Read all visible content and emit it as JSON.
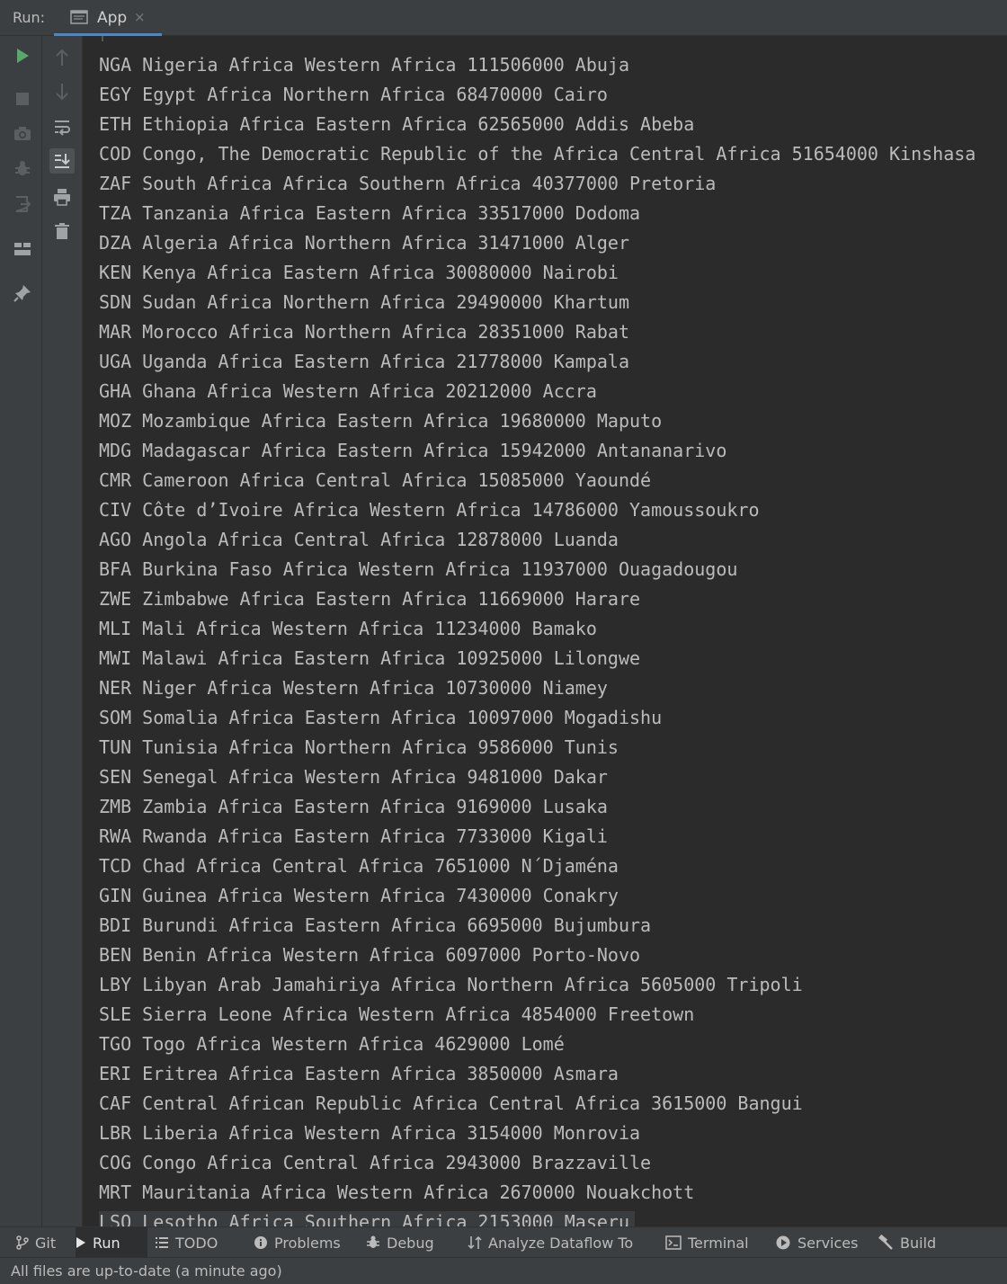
{
  "run_toolbar": {
    "run_label": "Run:",
    "tab_title": "App",
    "tab_close": "×"
  },
  "side_tools": [
    {
      "name": "rerun-icon"
    },
    {
      "name": "stop-icon"
    },
    {
      "name": "camera-icon"
    },
    {
      "name": "debug-icon"
    },
    {
      "name": "exit-icon"
    },
    {
      "name": "layout-icon"
    },
    {
      "name": "pin-icon"
    }
  ],
  "console_tools": [
    {
      "name": "scroll-up-icon"
    },
    {
      "name": "scroll-down-icon"
    },
    {
      "name": "soft-wrap-icon"
    },
    {
      "name": "scroll-to-end-icon"
    },
    {
      "name": "print-icon"
    },
    {
      "name": "trash-icon"
    }
  ],
  "console": {
    "lines": [
      "NGA Nigeria Africa Western Africa 111506000 Abuja",
      "EGY Egypt Africa Northern Africa 68470000 Cairo",
      "ETH Ethiopia Africa Eastern Africa 62565000 Addis Abeba",
      "COD Congo, The Democratic Republic of the Africa Central Africa 51654000 Kinshasa",
      "ZAF South Africa Africa Southern Africa 40377000 Pretoria",
      "TZA Tanzania Africa Eastern Africa 33517000 Dodoma",
      "DZA Algeria Africa Northern Africa 31471000 Alger",
      "KEN Kenya Africa Eastern Africa 30080000 Nairobi",
      "SDN Sudan Africa Northern Africa 29490000 Khartum",
      "MAR Morocco Africa Northern Africa 28351000 Rabat",
      "UGA Uganda Africa Eastern Africa 21778000 Kampala",
      "GHA Ghana Africa Western Africa 20212000 Accra",
      "MOZ Mozambique Africa Eastern Africa 19680000 Maputo",
      "MDG Madagascar Africa Eastern Africa 15942000 Antananarivo",
      "CMR Cameroon Africa Central Africa 15085000 Yaoundé",
      "CIV Côte d’Ivoire Africa Western Africa 14786000 Yamoussoukro",
      "AGO Angola Africa Central Africa 12878000 Luanda",
      "BFA Burkina Faso Africa Western Africa 11937000 Ouagadougou",
      "ZWE Zimbabwe Africa Eastern Africa 11669000 Harare",
      "MLI Mali Africa Western Africa 11234000 Bamako",
      "MWI Malawi Africa Eastern Africa 10925000 Lilongwe",
      "NER Niger Africa Western Africa 10730000 Niamey",
      "SOM Somalia Africa Eastern Africa 10097000 Mogadishu",
      "TUN Tunisia Africa Northern Africa 9586000 Tunis",
      "SEN Senegal Africa Western Africa 9481000 Dakar",
      "ZMB Zambia Africa Eastern Africa 9169000 Lusaka",
      "RWA Rwanda Africa Eastern Africa 7733000 Kigali",
      "TCD Chad Africa Central Africa 7651000 N´Djaména",
      "GIN Guinea Africa Western Africa 7430000 Conakry",
      "BDI Burundi Africa Eastern Africa 6695000 Bujumbura",
      "BEN Benin Africa Western Africa 6097000 Porto-Novo",
      "LBY Libyan Arab Jamahiriya Africa Northern Africa 5605000 Tripoli",
      "SLE Sierra Leone Africa Western Africa 4854000 Freetown",
      "TGO Togo Africa Western Africa 4629000 Lomé",
      "ERI Eritrea Africa Eastern Africa 3850000 Asmara",
      "CAF Central African Republic Africa Central Africa 3615000 Bangui",
      "LBR Liberia Africa Western Africa 3154000 Monrovia",
      "COG Congo Africa Central Africa 2943000 Brazzaville",
      "MRT Mauritania Africa Western Africa 2670000 Nouakchott",
      "LSO Lesotho Africa Southern Africa 2153000 Maseru"
    ]
  },
  "bottom_tabs": [
    {
      "label": "Git",
      "icon": "git-branch-icon"
    },
    {
      "label": "Run",
      "icon": "run-play-icon"
    },
    {
      "label": "TODO",
      "icon": "todo-list-icon"
    },
    {
      "label": "Problems",
      "icon": "problems-info-icon"
    },
    {
      "label": "Debug",
      "icon": "debug-bug-icon"
    },
    {
      "label": "Analyze Dataflow To",
      "icon": "dataflow-arrows-icon"
    },
    {
      "label": "Terminal",
      "icon": "terminal-icon"
    },
    {
      "label": "Services",
      "icon": "services-icon"
    },
    {
      "label": "Build",
      "icon": "build-hammer-icon"
    }
  ],
  "status_bar": {
    "text": "All files are up-to-date (a minute ago)"
  },
  "colors": {
    "accent": "#4a88c7",
    "run_green": "#59a869",
    "panel": "#3c3f41",
    "console_bg": "#2b2b2b"
  }
}
